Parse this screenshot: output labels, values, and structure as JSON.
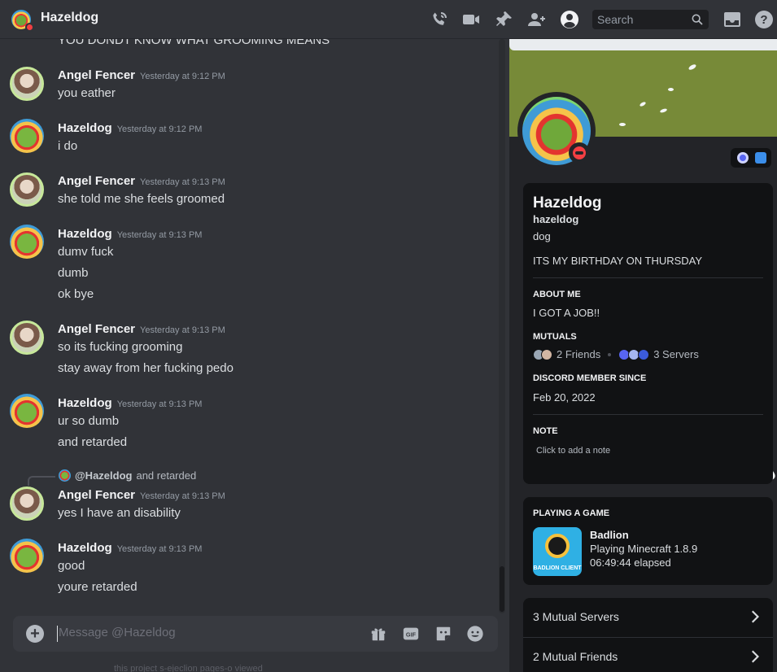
{
  "header": {
    "title": "Hazeldog",
    "search_placeholder": "Search",
    "icons": [
      "phone-call-icon",
      "video-call-icon",
      "pin-icon",
      "add-friend-icon",
      "user-profile-icon",
      "search-icon",
      "inbox-icon",
      "help-icon"
    ]
  },
  "chat": {
    "cut_message": "YOU DONDT KNOW WHAT GROOMING MEANS",
    "groups": [
      {
        "author": "Angel Fencer",
        "time": "Yesterday at 9:12 PM",
        "lines": [
          "you eather"
        ]
      },
      {
        "author": "Hazeldog",
        "time": "Yesterday at 9:12 PM",
        "lines": [
          "i do"
        ]
      },
      {
        "author": "Angel Fencer",
        "time": "Yesterday at 9:13 PM",
        "lines": [
          "she told me she feels groomed"
        ]
      },
      {
        "author": "Hazeldog",
        "time": "Yesterday at 9:13 PM",
        "lines": [
          "dumv fuck",
          "dumb",
          "ok bye"
        ]
      },
      {
        "author": "Angel Fencer",
        "time": "Yesterday at 9:13 PM",
        "lines": [
          "so its fucking grooming",
          "stay away from her fucking pedo"
        ]
      },
      {
        "author": "Hazeldog",
        "time": "Yesterday at 9:13 PM",
        "lines": [
          "ur so dumb",
          "and retarded"
        ]
      },
      {
        "author": "Angel Fencer",
        "time": "Yesterday at 9:13 PM",
        "lines": [
          "yes I have an disability"
        ]
      },
      {
        "author": "Hazeldog",
        "time": "Yesterday at 9:13 PM",
        "lines": [
          "good",
          "youre retarded"
        ]
      }
    ],
    "reply": {
      "mention": "@Hazeldog",
      "text": "and retarded"
    },
    "composer_placeholder": "Message @Hazeldog",
    "composer_icons": [
      "add-attachment-icon",
      "gift-icon",
      "gif-icon",
      "sticker-icon",
      "emoji-icon"
    ],
    "under_text": "this project s-ejeclion  pages-o  viewed"
  },
  "profile": {
    "display_name": "Hazeldog",
    "username": "hazeldog",
    "pronouns": "dog",
    "bio": "ITS MY BIRTHDAY ON THURSDAY",
    "about_me_label": "ABOUT ME",
    "about_me": "I GOT A JOB!!",
    "mutuals_label": "MUTUALS",
    "mutual_friends": "2 Friends",
    "mutual_servers": "3 Servers",
    "member_since_label": "DISCORD MEMBER SINCE",
    "member_since": "Feb 20, 2022",
    "note_label": "NOTE",
    "note_placeholder": "Click to add a note",
    "activity_label": "PLAYING A GAME",
    "game_name": "Badlion",
    "game_detail": "Playing Minecraft 1.8.9",
    "game_elapsed": "06:49:44 elapsed",
    "game_icon_text": "BADLION CLIENT",
    "mutual_servers_row": "3 Mutual Servers",
    "mutual_friends_row": "2 Mutual Friends",
    "status_color": "#f23f43",
    "banner_color": "#778a38"
  }
}
